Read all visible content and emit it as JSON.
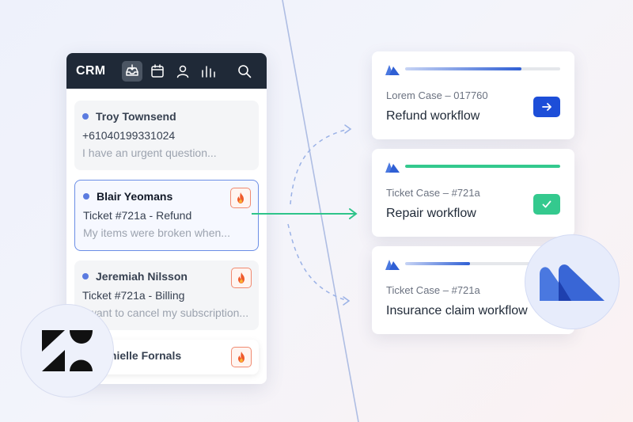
{
  "crm": {
    "title": "CRM",
    "nav_icons": [
      "inbox-icon",
      "calendar-icon",
      "user-icon",
      "chart-icon",
      "search-icon"
    ],
    "active_icon": "inbox-icon"
  },
  "tickets": [
    {
      "name": "Troy Townsend",
      "line": "+61040199331024",
      "sub": "I have an urgent question..."
    },
    {
      "name": "Blair Yeomans",
      "line": "Ticket #721a - Refund",
      "sub": "My items were broken when..."
    },
    {
      "name": "Jeremiah Nilsson",
      "line": "Ticket #721a - Billing",
      "sub": "I want to cancel my subscription..."
    },
    {
      "name": "Danielle Fornals"
    }
  ],
  "workflows": [
    {
      "case": "Lorem Case – 017760",
      "title": "Refund workflow",
      "progress": 0.75,
      "action": "arrow-right-icon"
    },
    {
      "case": "Ticket Case –  #721a",
      "title": "Repair workflow",
      "progress": 1.0,
      "action": "check-icon"
    },
    {
      "case": "Ticket Case –  #721a",
      "title": "Insurance claim workflow",
      "progress": 0.42
    }
  ],
  "colors": {
    "header": "#1f2937",
    "accent_blue": "#1d4ed8",
    "accent_green": "#34c98e",
    "fire": "#f08a70"
  }
}
